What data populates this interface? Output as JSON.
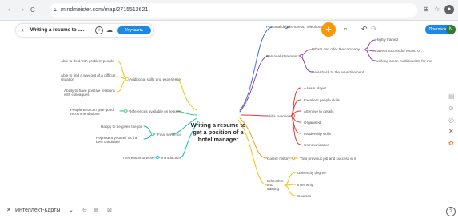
{
  "browser": {
    "url": "mindmeister.com/map/2715512621",
    "back": "←",
    "forward": "→",
    "reload": "C"
  },
  "app": {
    "title": "Writing a resume to ...",
    "more": "⌄",
    "upgrade_label": "Улучшить",
    "share_label": "Пригласить",
    "user_initial": "N",
    "bottom_brand": "Интеллект-Карты",
    "bottom_caret": "⌄",
    "help": "?"
  },
  "colors": {
    "accent_blue": "#1e88e5",
    "add_orange": "#ff9800",
    "avatar_green": "#2e7d32",
    "branch_blue": "#3f6ee8",
    "branch_purple": "#8e44ad",
    "branch_red": "#e53935",
    "branch_orange": "#f39c12",
    "branch_yellow": "#f1c40f",
    "branch_green": "#2ecc71",
    "branch_teal": "#1abc9c",
    "branch_cyan": "#00bcd4"
  },
  "map": {
    "central": "Writing a resume to get a position of a hotel manager",
    "personal_details": "Personal details",
    "personal_details_child": "Adress, Telephone, E-mail",
    "personal_statement": "Personal statement",
    "offer": "What I can offer the company",
    "offer_children": [
      "Highly trained",
      "have a successful record of ...",
      "working a non-multi tourists for me"
    ],
    "refer": "Refer back to the advertisement",
    "skills": "Skills overview",
    "skills_children": [
      "A team player",
      "Excellent people skills",
      "Attentive to details",
      "Organised",
      "Leadership skills",
      "Communicative"
    ],
    "career": "Career history",
    "career_child": "Your previous job and success in it",
    "education": "Education and training",
    "education_children": [
      "University degree",
      "Internship",
      "Courses"
    ],
    "additional": "Additional skills and experience",
    "additional_children": [
      "Able to deal with problem people",
      "Able to find a way out of a difficult situation",
      "Ability to have positive relations with colleagues"
    ],
    "references": "References available on request",
    "references_child": "People who can give good recommendations",
    "final": "Final sentence",
    "final_children": [
      "Happy to be given the job",
      "Represent yourself as the best candidate"
    ],
    "intro": "Introduction",
    "intro_child": "The reason to write"
  }
}
